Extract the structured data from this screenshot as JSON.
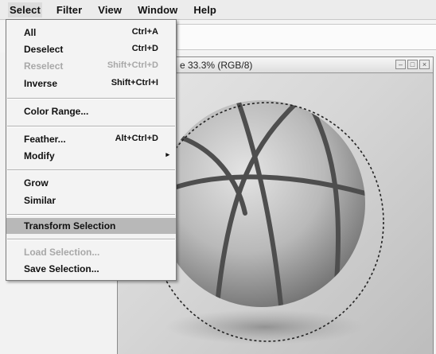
{
  "menubar": {
    "items": [
      "Select",
      "Filter",
      "View",
      "Window",
      "Help"
    ]
  },
  "document": {
    "title": "e 33.3% (RGB/8)"
  },
  "select_menu": {
    "all": {
      "label": "All",
      "shortcut": "Ctrl+A"
    },
    "deselect": {
      "label": "Deselect",
      "shortcut": "Ctrl+D"
    },
    "reselect": {
      "label": "Reselect",
      "shortcut": "Shift+Ctrl+D"
    },
    "inverse": {
      "label": "Inverse",
      "shortcut": "Shift+Ctrl+I"
    },
    "color_range": {
      "label": "Color Range..."
    },
    "feather": {
      "label": "Feather...",
      "shortcut": "Alt+Ctrl+D"
    },
    "modify": {
      "label": "Modify"
    },
    "grow": {
      "label": "Grow"
    },
    "similar": {
      "label": "Similar"
    },
    "transform_selection": {
      "label": "Transform Selection"
    },
    "load_selection": {
      "label": "Load Selection..."
    },
    "save_selection": {
      "label": "Save Selection..."
    }
  }
}
